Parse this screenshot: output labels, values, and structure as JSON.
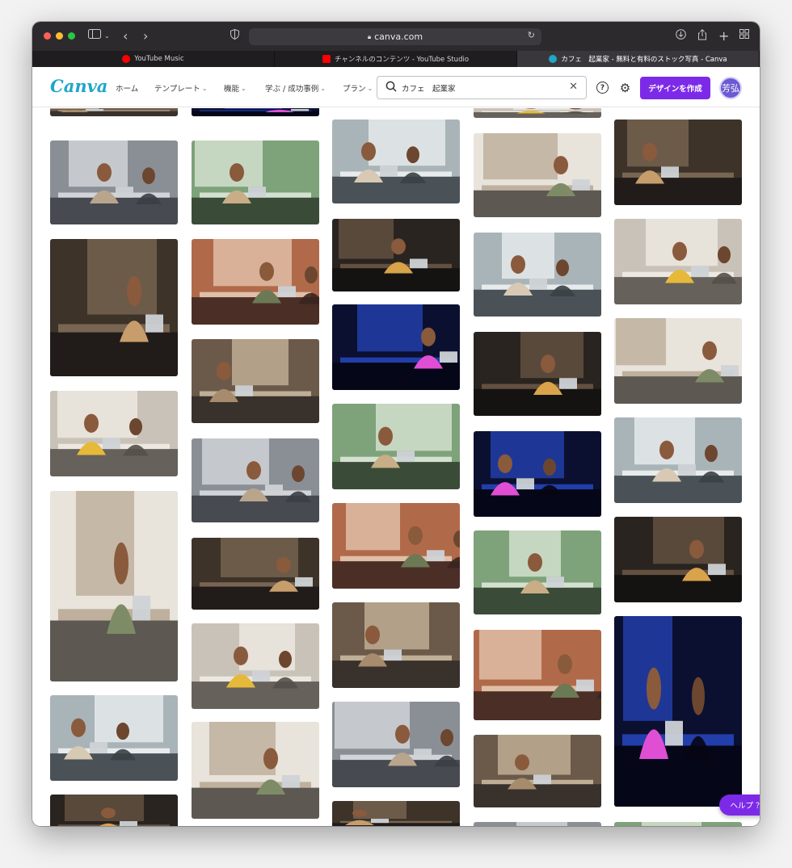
{
  "browser": {
    "url": "canva.com",
    "tabs": [
      {
        "label": "YouTube Music",
        "active": false
      },
      {
        "label": "チャンネルのコンテンツ - YouTube Studio",
        "active": false
      },
      {
        "label": "カフェ　起業家 - 無料と有料のストック写真 - Canva",
        "active": true
      }
    ]
  },
  "header": {
    "logo": "Canva",
    "nav": [
      {
        "label": "ホーム",
        "has_menu": false
      },
      {
        "label": "テンプレート",
        "has_menu": true
      },
      {
        "label": "機能",
        "has_menu": true
      },
      {
        "label": "学ぶ / 成功事例",
        "has_menu": true
      },
      {
        "label": "プラン",
        "has_menu": true
      }
    ],
    "search": {
      "value": "カフェ　起業家"
    },
    "create_button": "デザインを作成",
    "avatar": "芳弘"
  },
  "help_button": "ヘルプ ？",
  "colors": {
    "brand": "#7d2ae8",
    "logo": "#1fa6c9"
  },
  "photos": [
    [
      {
        "name": "photo-people-legs-cafe"
      },
      {
        "name": "photo-group-phones-cafe"
      },
      {
        "name": "photo-barista-tablet-apron"
      },
      {
        "name": "photo-woman-yellow-laptop"
      },
      {
        "name": "photo-man-laptop-brick-cafe"
      },
      {
        "name": "photo-woman-laptop-plants"
      },
      {
        "name": "photo-woman-cafe-bottles"
      }
    ],
    [
      {
        "name": "photo-man-cafe-dark"
      },
      {
        "name": "photo-cafe-window-city"
      },
      {
        "name": "photo-two-women-window-table"
      },
      {
        "name": "photo-man-phone-laptop-cafe"
      },
      {
        "name": "photo-men-brick-wall-laptop"
      },
      {
        "name": "photo-woman-pink-phone"
      },
      {
        "name": "photo-waitress-tablet-bar"
      },
      {
        "name": "photo-men-coffee-phone"
      }
    ],
    [
      {
        "name": "photo-woman-laptop-window"
      },
      {
        "name": "photo-man-smiling-laptop-cafe"
      },
      {
        "name": "photo-people-bright-cafe"
      },
      {
        "name": "photo-men-masks-laptop"
      },
      {
        "name": "photo-woman-hijab-laptop"
      },
      {
        "name": "photo-woman-blue-shirt-desk"
      },
      {
        "name": "photo-two-women-aprons-shop"
      },
      {
        "name": "photo-cafe-shelves"
      }
    ],
    [
      {
        "name": "photo-cafe-top-partial"
      },
      {
        "name": "photo-man-phone-laptop-plant"
      },
      {
        "name": "photo-meeting-tablet-table"
      },
      {
        "name": "photo-gamer-neon-room"
      },
      {
        "name": "photo-man-green-booth"
      },
      {
        "name": "photo-woman-plants-outdoor"
      },
      {
        "name": "photo-woman-yellow-cafe-counter"
      },
      {
        "name": "photo-hands-laptop-white"
      },
      {
        "name": "photo-cafe-bottom-partial"
      }
    ],
    [
      {
        "name": "photo-women-coffee-window"
      },
      {
        "name": "photo-men-brick-laptop-night"
      },
      {
        "name": "photo-woman-hijab-garden"
      },
      {
        "name": "photo-man-apron-shop"
      },
      {
        "name": "photo-men-kitchen-counter"
      },
      {
        "name": "photo-men-brick-fan-cafe"
      },
      {
        "name": "photo-cafe-bottom-row"
      }
    ]
  ]
}
